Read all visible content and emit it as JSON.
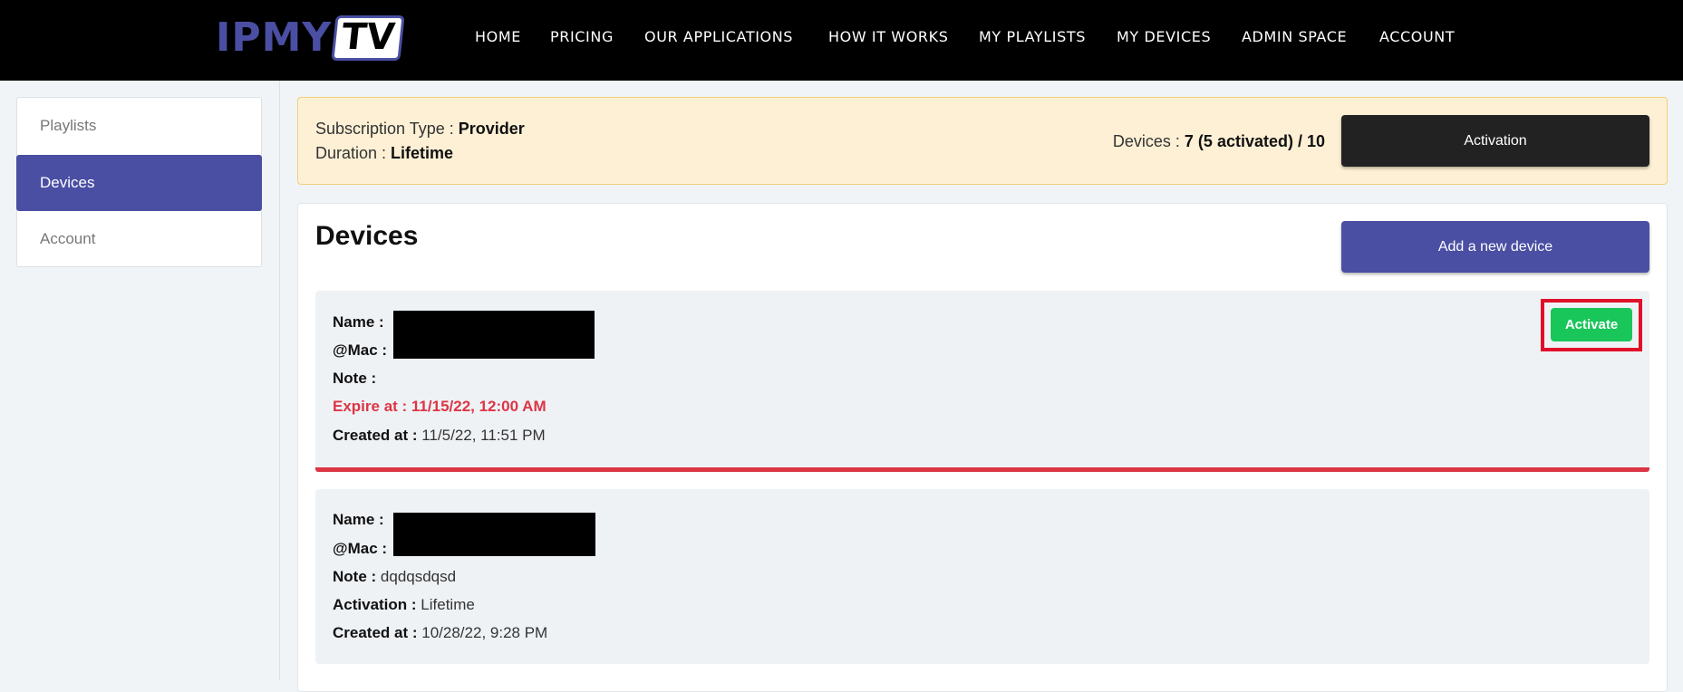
{
  "brand": {
    "logo_left": "IPMY",
    "logo_right": "TV"
  },
  "nav": {
    "items": [
      {
        "label": "HOME"
      },
      {
        "label": "PRICING"
      },
      {
        "label": "OUR APPLICATIONS"
      },
      {
        "label": "HOW IT WORKS"
      },
      {
        "label": "MY PLAYLISTS"
      },
      {
        "label": "MY DEVICES"
      },
      {
        "label": "ADMIN SPACE"
      },
      {
        "label": "ACCOUNT"
      }
    ]
  },
  "sidebar": {
    "items": [
      {
        "label": "Playlists",
        "active": false
      },
      {
        "label": "Devices",
        "active": true
      },
      {
        "label": "Account",
        "active": false
      }
    ]
  },
  "subscription": {
    "type_label": "Subscription Type : ",
    "type_value": "Provider",
    "duration_label": "Duration : ",
    "duration_value": "Lifetime",
    "devices_label": "Devices : ",
    "devices_value": "7 (5 activated) / 10",
    "activation_button": "Activation"
  },
  "devices": {
    "title": "Devices",
    "add_button": "Add a new device",
    "list": [
      {
        "name_label": "Name :",
        "mac_label": "@Mac :",
        "note_label": "Note :",
        "note_value": "",
        "expire_text": "Expire at : 11/15/22, 12:00 AM",
        "created_label": "Created at :",
        "created_value": "11/5/22, 11:51 PM",
        "activate_button": "Activate"
      },
      {
        "name_label": "Name :",
        "mac_label": "@Mac :",
        "note_label": "Note :",
        "note_value": "dqdqsdqsd",
        "activation_label": "Activation :",
        "activation_value": "Lifetime",
        "created_label": "Created at :",
        "created_value": "10/28/22, 9:28 PM"
      }
    ]
  },
  "colors": {
    "brand": "#4a4fa3",
    "header_bg": "#000000",
    "danger": "#dc3545",
    "success": "#19c65a",
    "banner_bg": "#fdf0d5",
    "highlight": "#e0102a"
  }
}
